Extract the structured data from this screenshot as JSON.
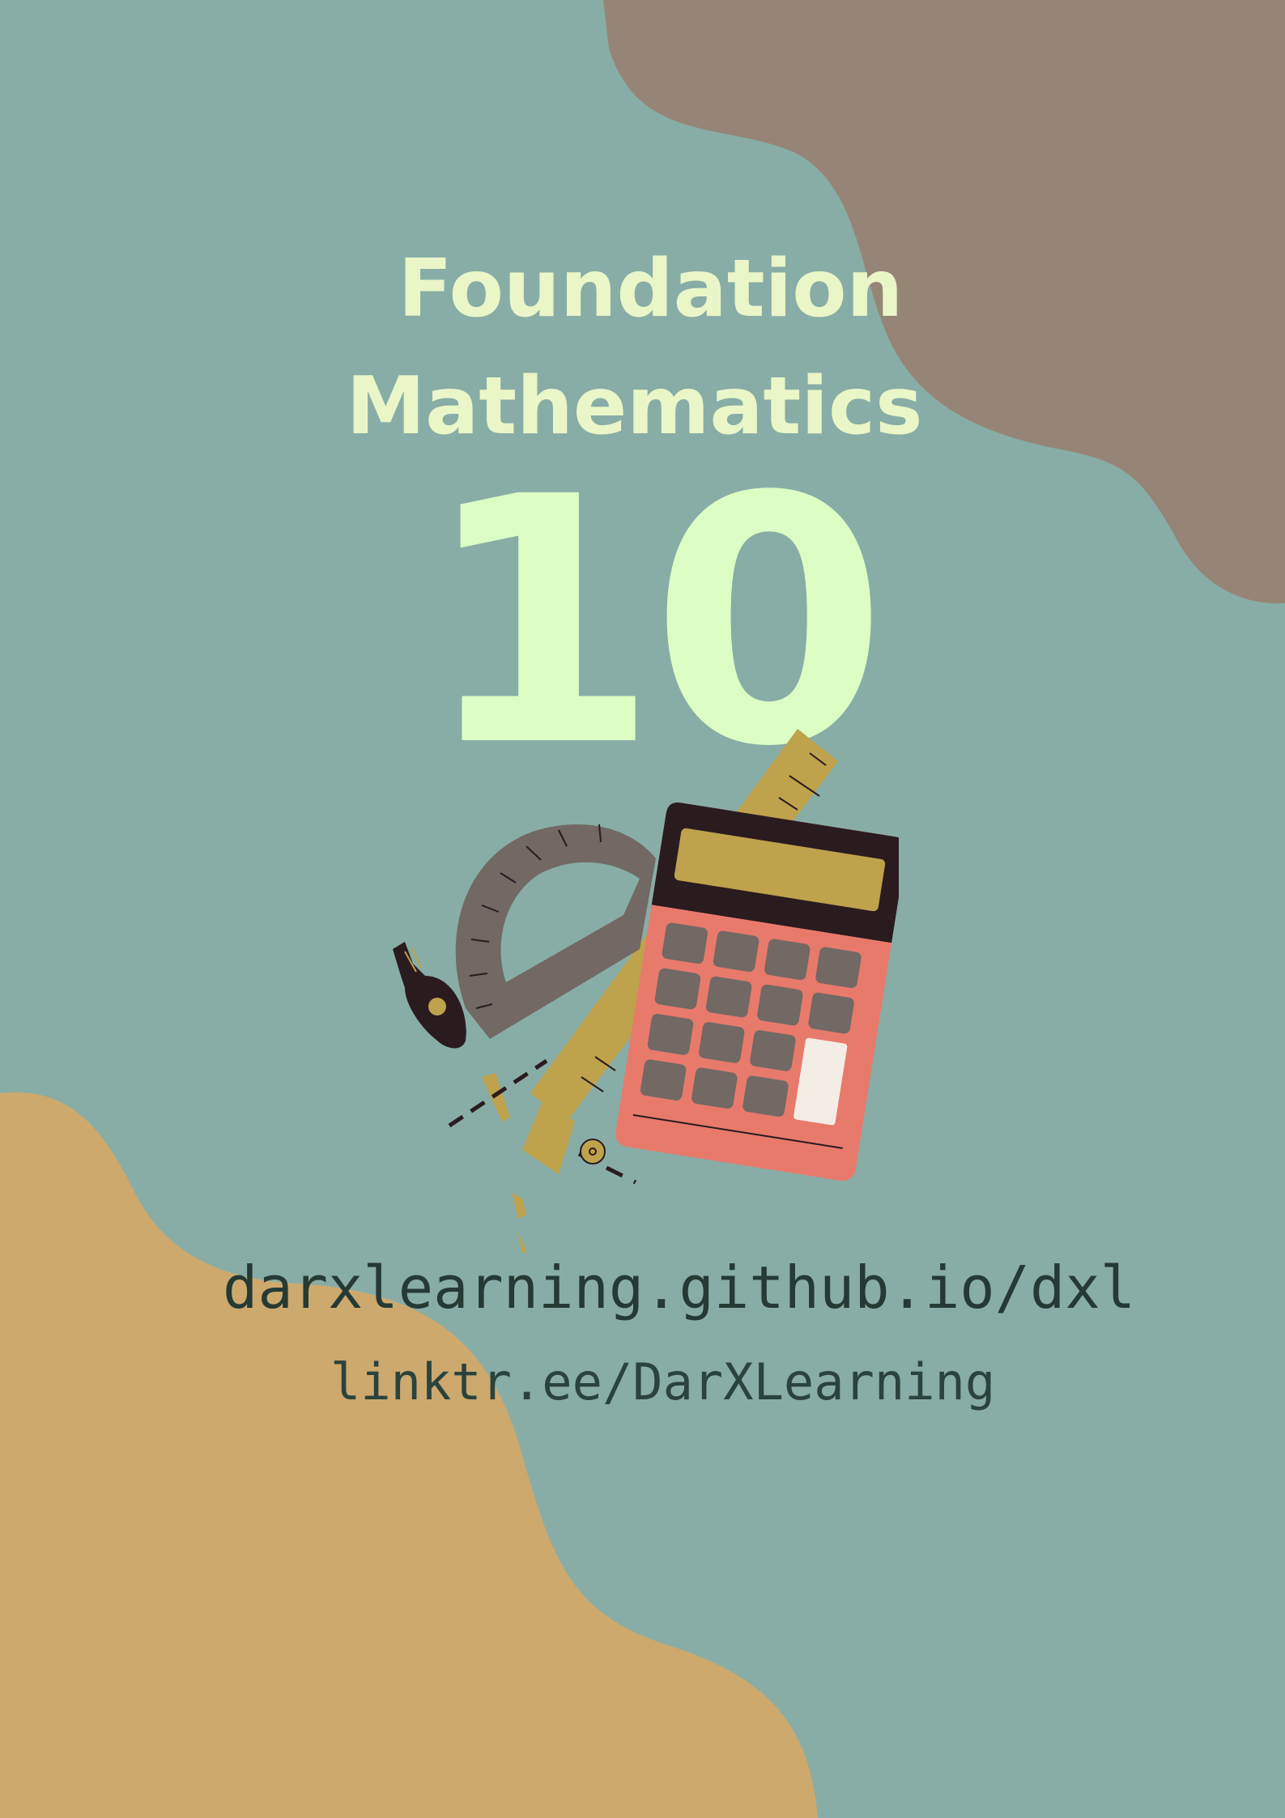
{
  "cover": {
    "title_line1": "Foundation",
    "title_line2": "Mathematics",
    "grade": "10",
    "link_primary": "darxlearning.github.io/dxl",
    "link_secondary": "linktr.ee/DarXLearning"
  },
  "colors": {
    "background": "#88ada6",
    "blob_top_right": "#968577",
    "blob_bottom_left": "#cda96e",
    "title": "#eaf6c8",
    "grade": "#dcfec4",
    "link_text": "#253a35"
  },
  "illustration": {
    "icons": [
      "calculator-icon",
      "protractor-icon",
      "ruler-icon",
      "compass-icon"
    ]
  }
}
